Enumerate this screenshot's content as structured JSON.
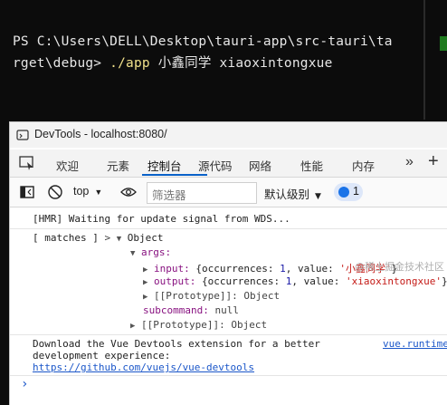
{
  "terminal": {
    "line1": "PS C:\\Users\\DELL\\Desktop\\tauri-app\\src-tauri\\ta",
    "line2_prefix": "rget\\debug> ",
    "line2_cmd": "./app",
    "line2_args": " 小鑫同学 xiaoxintongxue"
  },
  "devtools": {
    "title": "DevTools - localhost:8080/",
    "tabs": [
      "欢迎",
      "元素",
      "控制台",
      "源代码",
      "网络",
      "性能",
      "内存"
    ],
    "active_tab": "控制台",
    "more_label": "»",
    "add_label": "+",
    "context": "top",
    "filter_placeholder": "筛选器",
    "level": "默认级别",
    "issues_count": "1"
  },
  "console": {
    "hmr": "[HMR] Waiting for update signal from WDS...",
    "matches_label": "[ matches ]",
    "object_label": "Object",
    "args_key": "args:",
    "input_key": "input:",
    "input_pre": "{occurrences: ",
    "input_occ": "1",
    "input_mid": ", value: ",
    "input_val": "'小鑫同学'",
    "input_end": "}",
    "output_key": "output:",
    "output_pre": "{occurrences: ",
    "output_occ": "1",
    "output_mid": ", value: ",
    "output_val": "'xiaoxintongxue'",
    "output_end": "}",
    "prototype1": "[[Prototype]]: Object",
    "subcommand_key": "subcommand:",
    "subcommand_val": "null",
    "prototype2": "[[Prototype]]: Object",
    "vue_msg1": "Download the Vue Devtools extension for a better",
    "vue_msg2": "development experience:",
    "vue_link": "https://github.com/vuejs/vue-devtools",
    "vue_src": "vue.runtime",
    "prompt": "›"
  },
  "watermark": "@稀土掘金技术社区",
  "colors": {
    "accent": "#0a62c9",
    "string": "#c41a16",
    "key": "#881280",
    "number": "#1a1aa6"
  }
}
